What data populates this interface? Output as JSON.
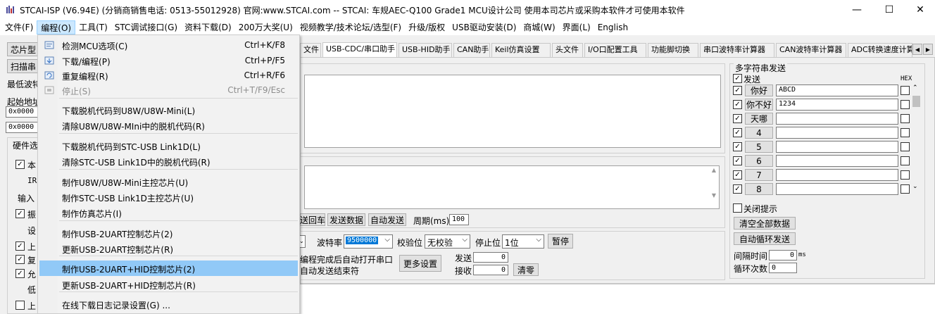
{
  "window": {
    "title": "STCAI-ISP (V6.94E) (分销商销售电话: 0513-55012928) 官网:www.STCAI.com  -- STCAI: 车规AEC-Q100 Grade1 MCU设计公司 使用本司芯片或采购本软件才可使用本软件",
    "minimize": "—",
    "maximize": "☐",
    "close": "✕"
  },
  "menubar": [
    "文件(F)",
    "编程(O)",
    "工具(T)",
    "STC调试接口(G)",
    "资料下载(D)",
    "200万大奖(U)",
    "视频教学/技术论坛/选型(F)",
    "升级/版权",
    "USB驱动安装(D)",
    "商城(W)",
    "界面(L)",
    "English"
  ],
  "left_panel": {
    "chip_btn": "芯片型",
    "scan_btn": "扫描串",
    "baud_label": "最低波特",
    "start_addr_label": "起始地址",
    "addr1": "0x0000",
    "addr2": "0x0000",
    "hw_group": "硬件选",
    "rows": [
      "本",
      "IR",
      "输入",
      "振",
      "设",
      "上",
      "复",
      "允",
      "低",
      "上"
    ]
  },
  "tabs": [
    "文件",
    "USB-CDC/串口助手",
    "USB-HID助手",
    "CAN助手",
    "Keil仿真设置",
    "头文件",
    "I/O口配置工具",
    "功能脚切换",
    "串口波特率计算器",
    "CAN波特率计算器",
    "ADC转换速度计算"
  ],
  "serial": {
    "send_echo": "送回车",
    "send_data": "发送数据",
    "auto_send": "自动发送",
    "period_label": "周期(ms)",
    "period_value": "100",
    "baud_label": "波特率",
    "baud_value": "9500000",
    "parity_label": "校验位",
    "parity_value": "无校验",
    "stop_label": "停止位",
    "stop_value": "1位",
    "pause": "暂停",
    "auto_open": "编程完成后自动打开串口",
    "auto_end": "自动发送结束符",
    "more_settings": "更多设置",
    "send_count_label": "发送",
    "send_count": "0",
    "recv_count_label": "接收",
    "recv_count": "0",
    "clear": "清零"
  },
  "multi_send": {
    "title": "多字符串发送",
    "send_header": "发送",
    "hex_header": "HEX",
    "rows": [
      {
        "label": "你好",
        "value": "ABCD"
      },
      {
        "label": "你不好",
        "value": "1234"
      },
      {
        "label": "天哪",
        "value": ""
      },
      {
        "label": "4",
        "value": ""
      },
      {
        "label": "5",
        "value": ""
      },
      {
        "label": "6",
        "value": ""
      },
      {
        "label": "7",
        "value": ""
      },
      {
        "label": "8",
        "value": ""
      }
    ],
    "close_tip": "关闭提示",
    "clear_all": "清空全部数据",
    "auto_loop": "自动循环发送",
    "interval_label": "间隔时间",
    "interval_value": "0",
    "interval_unit": "ms",
    "loop_label": "循环次数",
    "loop_value": "0"
  },
  "dropdown": {
    "items": [
      {
        "label": "检测MCU选项(C)",
        "shortcut": "Ctrl+K/F8",
        "icon": "check-icon"
      },
      {
        "label": "下载/编程(P)",
        "shortcut": "Ctrl+P/F5",
        "icon": "download-icon"
      },
      {
        "label": "重复编程(R)",
        "shortcut": "Ctrl+R/F6",
        "icon": "repeat-icon"
      },
      {
        "label": "停止(S)",
        "shortcut": "Ctrl+T/F9/Esc",
        "icon": "stop-icon",
        "disabled": true
      },
      {
        "label": "下载脱机代码到U8W/U8W-Mini(L)"
      },
      {
        "label": "清除U8W/U8W-MIni中的脱机代码(R)"
      },
      {
        "label": "下载脱机代码到STC-USB Link1D(L)"
      },
      {
        "label": "清除STC-USB Link1D中的脱机代码(R)"
      },
      {
        "label": "制作U8W/U8W-Mini主控芯片(U)"
      },
      {
        "label": "制作STC-USB Link1D主控芯片(U)"
      },
      {
        "label": "制作仿真芯片(I)"
      },
      {
        "label": "制作USB-2UART控制芯片(2)"
      },
      {
        "label": "更新USB-2UART控制芯片(R)"
      },
      {
        "label": "制作USB-2UART+HID控制芯片(2)",
        "highlighted": true
      },
      {
        "label": "更新USB-2UART+HID控制芯片(R)"
      },
      {
        "label": "在线下载日志记录设置(G) ..."
      }
    ]
  }
}
